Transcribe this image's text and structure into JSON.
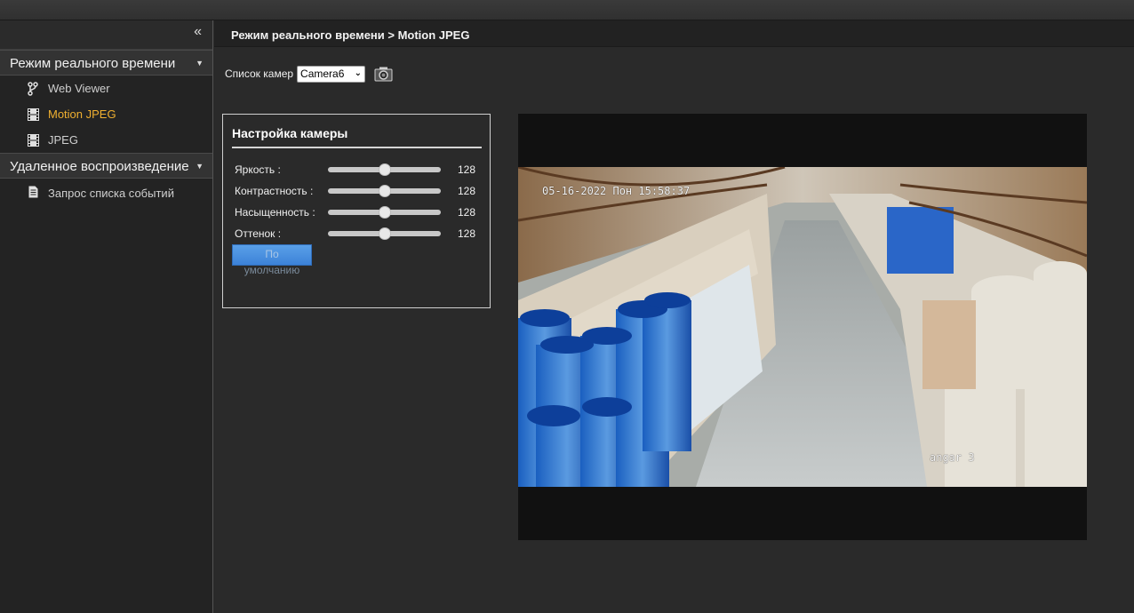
{
  "sidebar": {
    "collapse_icon": "«",
    "sections": [
      {
        "label": "Режим реального времени",
        "items": [
          {
            "label": "Web Viewer",
            "icon": "fork-icon",
            "active": false
          },
          {
            "label": "Motion JPEG",
            "icon": "film-icon",
            "active": true
          },
          {
            "label": "JPEG",
            "icon": "film-icon",
            "active": false
          }
        ]
      },
      {
        "label": "Удаленное воспроизведение",
        "items": [
          {
            "label": "Запрос списка событий",
            "icon": "document-icon",
            "active": false
          }
        ]
      }
    ]
  },
  "breadcrumb": "Режим реального времени > Motion JPEG",
  "camera": {
    "label": "Список камер",
    "selected": "Camera6"
  },
  "settings": {
    "title": "Настройка камеры",
    "sliders": [
      {
        "label": "Яркость :",
        "value": 128,
        "max": 255
      },
      {
        "label": "Контрастность :",
        "value": 128,
        "max": 255
      },
      {
        "label": "Насыщенность :",
        "value": 128,
        "max": 255
      },
      {
        "label": "Оттенок :",
        "value": 128,
        "max": 255
      }
    ],
    "default_btn_line1": "По",
    "default_btn_line2": "умолчанию"
  },
  "video": {
    "timestamp": "05-16-2022 Пон 15:58:37",
    "camera_name": "angar 3"
  },
  "colors": {
    "accent_active": "#f0b030",
    "button_blue": "#4a90e2"
  }
}
